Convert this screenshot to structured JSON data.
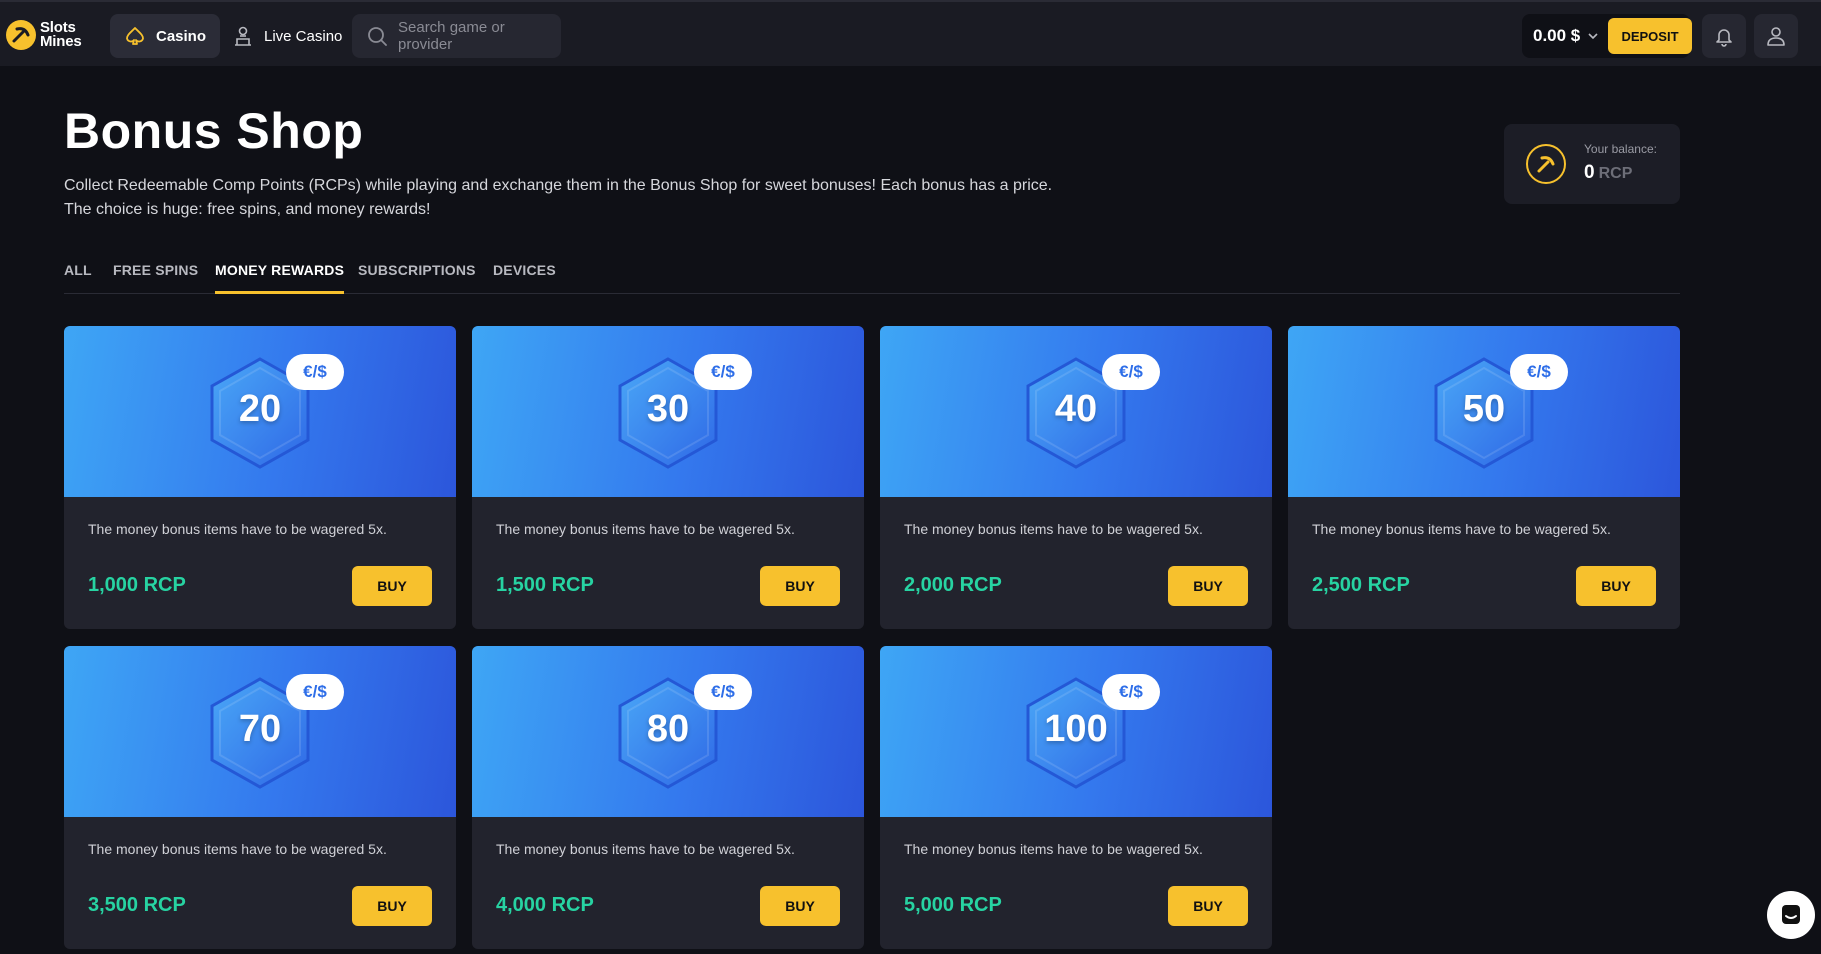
{
  "header": {
    "logo_line1": "Slots",
    "logo_line2": "Mines",
    "nav": [
      {
        "label": "Casino",
        "icon": "spade-icon",
        "active": true
      },
      {
        "label": "Live Casino",
        "icon": "dealer-icon",
        "active": false
      }
    ],
    "search_placeholder": "Search game or provider",
    "wallet_amount": "0.00 $",
    "deposit_label": "DEPOSIT"
  },
  "page": {
    "title": "Bonus Shop",
    "description_line1": "Collect Redeemable Comp Points (RCPs) while playing and exchange them in the Bonus Shop for sweet bonuses! Each bonus has a price.",
    "description_line2": "The choice is huge: free spins, and money rewards!",
    "balance_label": "Your balance:",
    "balance_value": "0",
    "balance_unit": "RCP"
  },
  "tabs": [
    {
      "label": "ALL",
      "active": false
    },
    {
      "label": "FREE SPINS",
      "active": false
    },
    {
      "label": "MONEY REWARDS",
      "active": true
    },
    {
      "label": "SUBSCRIPTIONS",
      "active": false
    },
    {
      "label": "DEVICES",
      "active": false
    }
  ],
  "cards": [
    {
      "amount": "20",
      "currency": "€/$",
      "note": "The money bonus items have to be wagered 5x.",
      "price": "1,000 RCP",
      "buy": "BUY"
    },
    {
      "amount": "30",
      "currency": "€/$",
      "note": "The money bonus items have to be wagered 5x.",
      "price": "1,500 RCP",
      "buy": "BUY"
    },
    {
      "amount": "40",
      "currency": "€/$",
      "note": "The money bonus items have to be wagered 5x.",
      "price": "2,000 RCP",
      "buy": "BUY"
    },
    {
      "amount": "50",
      "currency": "€/$",
      "note": "The money bonus items have to be wagered 5x.",
      "price": "2,500 RCP",
      "buy": "BUY"
    },
    {
      "amount": "70",
      "currency": "€/$",
      "note": "The money bonus items have to be wagered 5x.",
      "price": "3,500 RCP",
      "buy": "BUY"
    },
    {
      "amount": "80",
      "currency": "€/$",
      "note": "The money bonus items have to be wagered 5x.",
      "price": "4,000 RCP",
      "buy": "BUY"
    },
    {
      "amount": "100",
      "currency": "€/$",
      "note": "The money bonus items have to be wagered 5x.",
      "price": "5,000 RCP",
      "buy": "BUY"
    }
  ],
  "colors": {
    "accent": "#f7c12d",
    "price": "#27d3a2",
    "background": "#0f1016",
    "card": "#22232d"
  }
}
